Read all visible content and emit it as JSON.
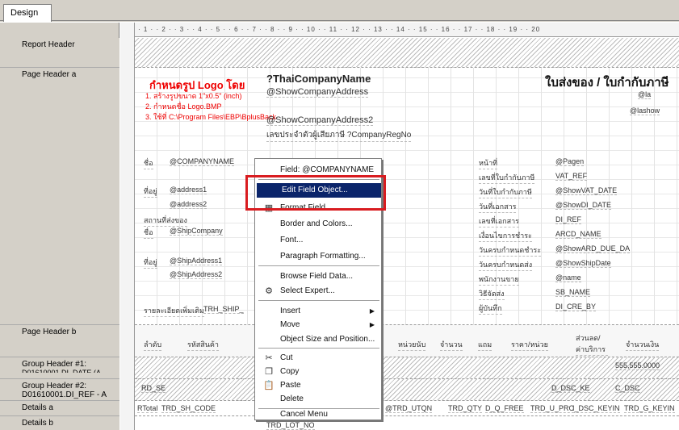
{
  "tab": {
    "design": "Design"
  },
  "ruler_text": "· 1 · · 2 · · 3 · · 4 · · 5 · · 6 · · 7 · · 8 · · 9 · · 10 · · 11 · · 12 · · 13 · · 14 · · 15 · · 16 · · 17 · · 18 · · 19 · · 20",
  "sections": {
    "report_header": "Report Header",
    "page_header_a": "Page Header a",
    "page_header_b": "Page Header b",
    "group_header_1": "Group Header #1:",
    "group_header_1_sub": "D01610001.DI_DATE (A",
    "group_header_2": "Group Header #2:",
    "group_header_2_sub": "D01610001.DI_REF - A",
    "details_a": "Details a",
    "details_b": "Details b"
  },
  "logo_note": {
    "title": "กำหนดรูป Logo โดย",
    "line1": "1. สร้างรูปขนาด 1\"x0.5\" (inch)",
    "line2": "2. กำหนดชื่อ Logo.BMP",
    "line3": "3. ใช้ที่ C:\\Program Files\\EBP\\BplusBack"
  },
  "company": {
    "name": "?ThaiCompanyName",
    "address": "@ShowCompanyAddress",
    "address2": "@ShowCompanyAddress2",
    "taxid": "เลขประจำตัวผู้เสียภาษี ?CompanyRegNo"
  },
  "doc_title": "ใบส่งของ / ใบกำกับภาษี",
  "barcode_tags": {
    "a": "@la",
    "b": "@lashow"
  },
  "fields": {
    "companyname": "@COMPANYNAME",
    "address1": "@address1",
    "address2": "@address2",
    "shipcompany": "@ShipCompany",
    "shipaddress1": "@ShipAddress1",
    "shipaddress2": "@ShipAddress2",
    "trh_ship": "TRH_SHIP_"
  },
  "left_labels": [
    "ชื่อ",
    "ที่อยู่",
    "สถานที่ส่งของ",
    "ชื่อ",
    "ที่อยู่",
    "รายละเอียดเพิ่มเติม"
  ],
  "right_labels": [
    "หน้าที่",
    "เลขที่ใบกำกับภาษี",
    "วันที่ใบกำกับภาษี",
    "วันที่เอกสาร",
    "เลขที่เอกสาร",
    "เงื่อนไขการชำระ",
    "วันครบกำหนดชำระ",
    "วันครบกำหนดส่ง",
    "พนักงานขาย",
    "วิธีจัดส่ง",
    "ผู้บันทึก"
  ],
  "right_fields": [
    "@Pagen",
    "VAT_REF",
    "@ShowVAT_DATE",
    "@ShowDI_DATE",
    "DI_REF",
    "ARCD_NAME",
    "@ShowARD_DUE_DA",
    "@ShowShipDate",
    "@name",
    "SB_NAME",
    "DI_CRE_BY"
  ],
  "table_headers": [
    "ลำดับ",
    "รหัสสินค้า",
    "หน่วยนับ",
    "จำนวน",
    "แถม",
    "ราคา/หน่วย",
    "ส่วนลด/ ค่าบริการ",
    "จำนวนเงิน"
  ],
  "group1_value": "555,555.0000",
  "group2": {
    "rd_se": "RD_SE",
    "dsc_ke": "D_DSC_KE",
    "c_dsc": "C_DSC"
  },
  "details_a_fields": [
    "RTotal",
    "TRD_SH_CODE",
    "@TRD_UTQN",
    "TRD_QTY",
    "D_Q_FREE",
    "TRD_U_PRC",
    "I_DSC_KEYIN",
    "TRD_G_KEYIN"
  ],
  "details_b_field": "TRD_LOT_NO",
  "context_menu": {
    "header": "Field: @COMPANYNAME",
    "edit_field_object": "Edit Field Object...",
    "format_field": "Format Field...",
    "border_colors": "Border and Colors...",
    "font": "Font...",
    "paragraph": "Paragraph Formatting...",
    "browse": "Browse Field Data...",
    "select_expert": "Select Expert...",
    "insert": "Insert",
    "move": "Move",
    "object_size": "Object Size and Position...",
    "cut": "Cut",
    "copy": "Copy",
    "paste": "Paste",
    "delete": "Delete",
    "cancel": "Cancel Menu"
  },
  "colors": {
    "highlight": "#0a246a",
    "callout": "#d91c20",
    "note_red": "#e00000"
  }
}
